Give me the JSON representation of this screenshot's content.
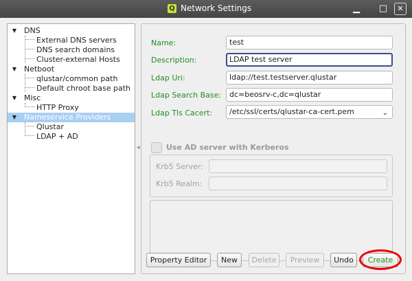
{
  "window": {
    "title": "Network Settings",
    "app_icon_glyph": "Q",
    "minimize_glyph": "▁",
    "maximize_glyph": "□",
    "close_glyph": "✕"
  },
  "tree": {
    "expanded_glyph": "▼",
    "groups": [
      {
        "label": "DNS",
        "children": [
          "External DNS servers",
          "DNS search domains",
          "Cluster-external Hosts"
        ]
      },
      {
        "label": "Netboot",
        "children": [
          "qlustar/common path",
          "Default chroot base path"
        ]
      },
      {
        "label": "Misc",
        "children": [
          "HTTP Proxy"
        ]
      },
      {
        "label": "Nameservice Providers",
        "selected": true,
        "children": [
          "Qlustar",
          "LDAP + AD"
        ]
      }
    ]
  },
  "splitter_glyph": "◂",
  "form": {
    "name_label": "Name:",
    "name_value": "test",
    "description_label": "Description:",
    "description_value": "LDAP test server",
    "ldap_uri_label": "Ldap Uri:",
    "ldap_uri_value": "ldap://test.testserver.qlustar",
    "ldap_search_base_label": "Ldap Search Base:",
    "ldap_search_base_value": "dc=beosrv-c,dc=qlustar",
    "ldap_tls_cacert_label": "Ldap Tls Cacert:",
    "ldap_tls_cacert_value": "/etc/ssl/certs/qlustar-ca-cert.pem",
    "combo_arrow_glyph": "⌄",
    "use_ad_label": "Use AD server with Kerberos",
    "krb5_server_label": "Krb5 Server:",
    "krb5_server_value": "",
    "krb5_realm_label": "Krb5 Realm:",
    "krb5_realm_value": ""
  },
  "buttons": {
    "property_editor": "Property Editor",
    "new": "New",
    "delete": "Delete",
    "preview": "Preview",
    "undo": "Undo",
    "create": "Create"
  },
  "colors": {
    "label_green": "#228b22",
    "selection_blue": "#a9cff2",
    "highlight_red": "#ee0000"
  }
}
